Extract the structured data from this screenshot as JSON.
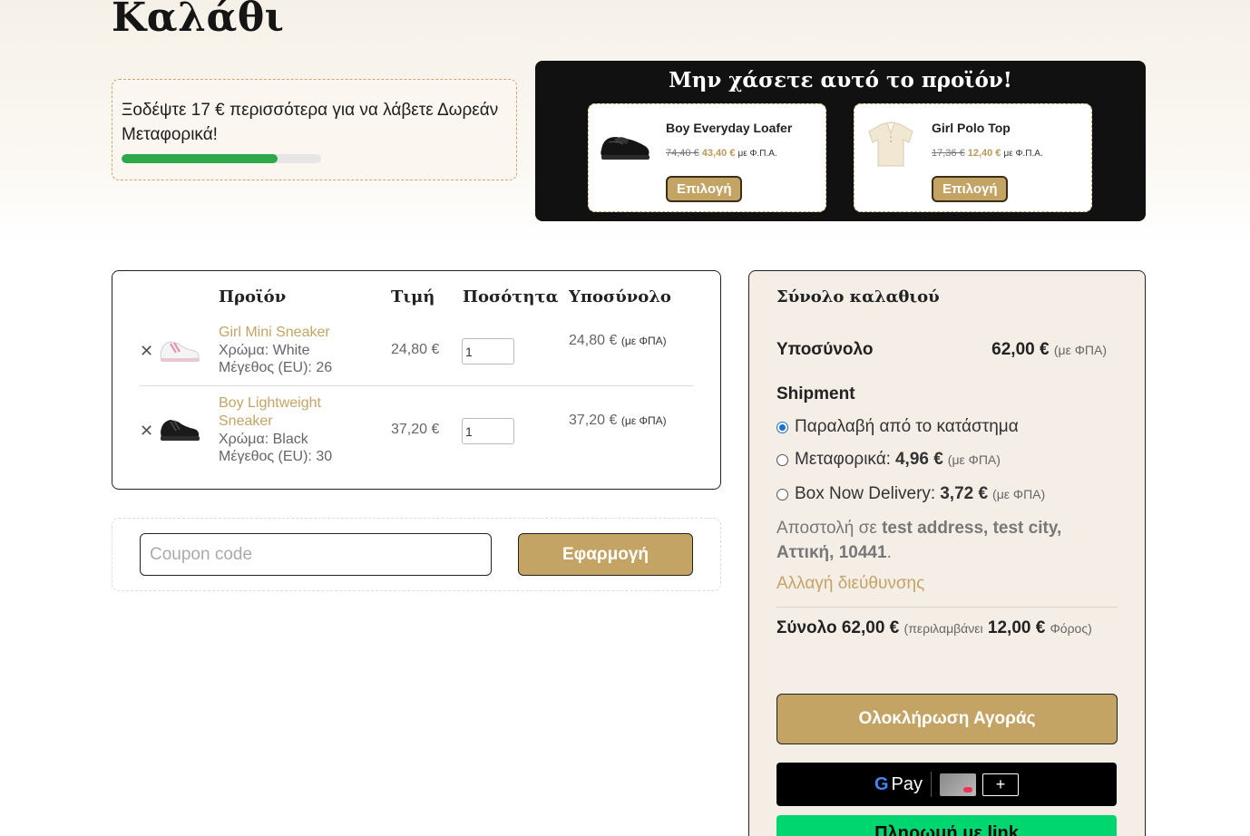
{
  "page": {
    "title": "Καλάθι"
  },
  "free_shipping": {
    "message": "Ξοδέψτε 17 € περισσότερα για να λάβετε Δωρεάν Μεταφορικά!",
    "progress_percent": 78
  },
  "upsell": {
    "title": "Μην χάσετε αυτό το προϊόν!",
    "products": [
      {
        "name": "Boy Everyday Loafer",
        "old_price": "74,40 €",
        "new_price": "43,40 €",
        "vat": "με Φ.Π.Α.",
        "button": "Επιλογή",
        "icon": "black-loafer-shoe"
      },
      {
        "name": "Girl Polo Top",
        "old_price": "17,36 €",
        "new_price": "12,40 €",
        "vat": "με Φ.Π.Α.",
        "button": "Επιλογή",
        "icon": "cream-polo-shirt"
      }
    ]
  },
  "cart": {
    "headers": {
      "product": "Προϊόν",
      "price": "Τιμή",
      "quantity": "Ποσότητα",
      "subtotal": "Υποσύνολο"
    },
    "remove_symbol": "✕",
    "items": [
      {
        "name": "Girl Mini Sneaker",
        "color": "Χρώμα: White",
        "size": "Μέγεθος (EU): 26",
        "price": "24,80 €",
        "quantity": "1",
        "subtotal": "24,80 €",
        "vat": "(με ΦΠΑ)",
        "icon": "white-pink-sneaker"
      },
      {
        "name": "Boy Lightweight Sneaker",
        "color": "Χρώμα: Black",
        "size": "Μέγεθος (EU): 30",
        "price": "37,20 €",
        "quantity": "1",
        "subtotal": "37,20 €",
        "vat": "(με ΦΠΑ)",
        "icon": "black-sneaker"
      }
    ]
  },
  "coupon": {
    "placeholder": "Coupon code",
    "button": "Εφαρμογή"
  },
  "totals": {
    "title": "Σύνολο καλαθιού",
    "subtotal_label": "Υποσύνολο",
    "subtotal_value": "62,00 €",
    "vat_note": "(με ΦΠΑ)",
    "shipment_label": "Shipment",
    "shipping_options": [
      {
        "label": "Παραλαβή από το κατάστημα",
        "price": "",
        "note": "",
        "selected": true
      },
      {
        "label": "Μεταφορικά:",
        "price": "4,96 €",
        "note": "(με ΦΠΑ)",
        "selected": false
      },
      {
        "label": "Box Now Delivery:",
        "price": "3,72 €",
        "note": "(με ΦΠΑ)",
        "selected": false
      }
    ],
    "ship_dest_prefix": "Αποστολή σε",
    "ship_dest_address": "test address, test city, Αττική, 10441",
    "change_address": "Αλλαγή διεύθυνσης",
    "total_label": "Σύνολο",
    "total_value": "62,00 €",
    "tax_includes": "(περιλαμβάνει",
    "tax_value": "12,00 €",
    "tax_label": "Φόρος)",
    "checkout_button": "Ολοκλήρωση Αγοράς",
    "gpay_label": "Pay",
    "gpay_g": "G",
    "gpay_plus": "+",
    "link_label": "Πληρωμή με link"
  }
}
